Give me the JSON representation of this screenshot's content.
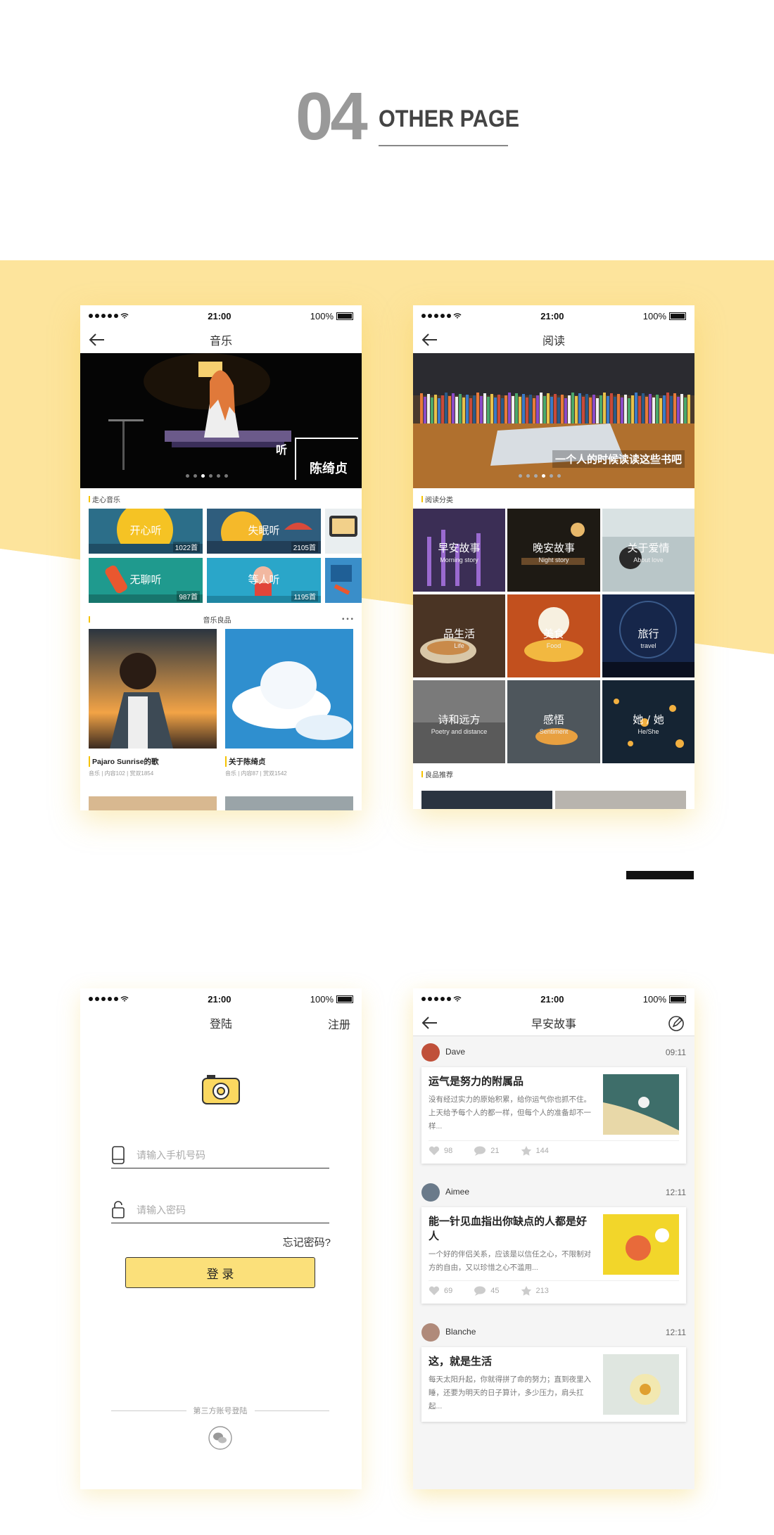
{
  "header": {
    "number": "04",
    "title": "OTHER PAGE"
  },
  "status": {
    "time": "21:00",
    "battery": "100%"
  },
  "music": {
    "title": "音乐",
    "banner_label": "听",
    "banner_artist": "陈绮贞",
    "section1": "走心音乐",
    "moods": [
      {
        "name": "开心听",
        "count": "1022首"
      },
      {
        "name": "失眠听",
        "count": "2105首"
      },
      {
        "name": "无聊听",
        "count": "987首"
      },
      {
        "name": "等人听",
        "count": "1195首"
      }
    ],
    "section2": "音乐良品",
    "more": "• • •",
    "albums": [
      {
        "title": "Pajaro Sunrise的歌",
        "meta": "音乐 | 内容102 | 赏双1854"
      },
      {
        "title": "关于陈绮贞",
        "meta": "音乐 | 内容87 | 赏双1542"
      }
    ]
  },
  "reading": {
    "title": "阅读",
    "banner_caption": "一个人的时候读读这些书吧",
    "section1": "阅读分类",
    "categories": [
      {
        "name": "早安故事",
        "sub": "Morning story"
      },
      {
        "name": "晚安故事",
        "sub": "Night story"
      },
      {
        "name": "关于爱情",
        "sub": "About love"
      },
      {
        "name": "品生活",
        "sub": "Life"
      },
      {
        "name": "美食",
        "sub": "Food"
      },
      {
        "name": "旅行",
        "sub": "travel"
      },
      {
        "name": "诗和远方",
        "sub": "Poetry and distance"
      },
      {
        "name": "感悟",
        "sub": "Sentiment"
      },
      {
        "name": "她 / 她",
        "sub": "He/She"
      }
    ],
    "section2": "良品推荐"
  },
  "login": {
    "title": "登陆",
    "register": "注册",
    "phone_placeholder": "请输入手机号码",
    "password_placeholder": "请输入密码",
    "forgot": "忘记密码?",
    "login_button": "登 录",
    "third_party": "第三方账号登陆"
  },
  "story": {
    "title": "早安故事",
    "posts": [
      {
        "user": "Dave",
        "time": "09:11",
        "title": "运气是努力的附属品",
        "body": "没有经过实力的原始积累，给你运气你也抓不住。上天给予每个人的都一样，但每个人的准备却不一样...",
        "likes": "98",
        "comments": "21",
        "stars": "144"
      },
      {
        "user": "Aimee",
        "time": "12:11",
        "title": "能一针见血指出你缺点的人都是好人",
        "body": "一个好的伴侣关系，应该是以信任之心，不限制对方的自由，又以珍惜之心不滥用...",
        "likes": "69",
        "comments": "45",
        "stars": "213"
      },
      {
        "user": "Blanche",
        "time": "12:11",
        "title": "这，就是生活",
        "body": "每天太阳升起，你就得拼了命的努力；直到夜里入睡，还要为明天的日子算计，多少压力，肩头扛起...",
        "likes": "",
        "comments": "",
        "stars": ""
      }
    ]
  }
}
